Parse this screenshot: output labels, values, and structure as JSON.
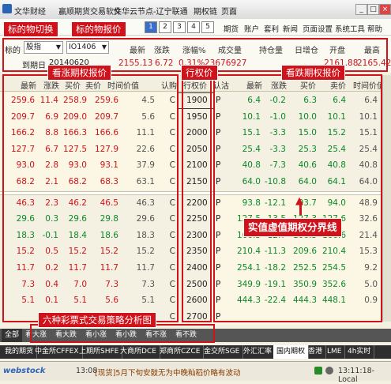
{
  "window": {
    "app_name": "文华财经",
    "title_segments": [
      "赢顺期货交易软件",
      "文华云节点-辽宁联通",
      "期权链",
      "页面"
    ]
  },
  "menu": {
    "items": [
      "期货",
      "账户",
      "套利",
      "新闻",
      "页面设置",
      "系统工具",
      "帮助"
    ],
    "page_numbers": [
      "1",
      "2",
      "3",
      "4",
      "5"
    ],
    "active_page_index": 0
  },
  "selector": {
    "label": "标的",
    "category": "股指",
    "contract": "IO1406",
    "row2_label": "到期日",
    "row2_date": "20140620",
    "headers": [
      "最新",
      "涨跌",
      "涨幅%",
      "成交量",
      "持仓量",
      "日增仓",
      "开盘",
      "最高"
    ],
    "values": [
      "2155.13",
      "6.72",
      "0.31%",
      "23676927",
      "",
      "",
      "2161.88",
      "2165.42"
    ]
  },
  "chain": {
    "call_headers": [
      "最新",
      "涨跌",
      "买价",
      "卖价",
      "时间价值",
      "认购"
    ],
    "strike_header": "行权价",
    "put_headers": [
      "认沽",
      "最新",
      "涨跌",
      "买价",
      "卖价",
      "时间价值"
    ],
    "rows": [
      {
        "call": [
          "259.6",
          "11.4",
          "258.9",
          "259.6",
          "4.5",
          "C"
        ],
        "strike": "1900",
        "put": [
          "P",
          "6.4",
          "-0.2",
          "6.3",
          "6.4",
          "6.4"
        ]
      },
      {
        "call": [
          "209.7",
          "6.9",
          "209.0",
          "209.7",
          "5.6",
          "C"
        ],
        "strike": "1950",
        "put": [
          "P",
          "10.1",
          "-1.0",
          "10.0",
          "10.1",
          "10.1"
        ]
      },
      {
        "call": [
          "166.2",
          "8.8",
          "166.3",
          "166.6",
          "11.1",
          "C"
        ],
        "strike": "2000",
        "put": [
          "P",
          "15.1",
          "-3.3",
          "15.0",
          "15.2",
          "15.1"
        ]
      },
      {
        "call": [
          "127.7",
          "6.7",
          "127.5",
          "127.9",
          "22.6",
          "C"
        ],
        "strike": "2050",
        "put": [
          "P",
          "25.4",
          "-3.3",
          "25.3",
          "25.4",
          "25.4"
        ]
      },
      {
        "call": [
          "93.0",
          "2.8",
          "93.0",
          "93.1",
          "37.9",
          "C"
        ],
        "strike": "2100",
        "put": [
          "P",
          "40.8",
          "-7.3",
          "40.6",
          "40.8",
          "40.8"
        ]
      },
      {
        "call": [
          "68.2",
          "2.1",
          "68.2",
          "68.3",
          "63.1",
          "C"
        ],
        "strike": "2150",
        "put": [
          "P",
          "64.0",
          "-10.8",
          "64.0",
          "64.1",
          "64.0"
        ]
      },
      {
        "call": [
          "46.3",
          "2.3",
          "46.2",
          "46.5",
          "46.3",
          "C"
        ],
        "strike": "2200",
        "put": [
          "P",
          "93.8",
          "-12.1",
          "93.7",
          "94.0",
          "48.9"
        ]
      },
      {
        "call": [
          "29.6",
          "0.3",
          "29.6",
          "29.8",
          "29.6",
          "C"
        ],
        "strike": "2250",
        "put": [
          "P",
          "127.5",
          "-13.5",
          "127.3",
          "127.6",
          "32.6"
        ]
      },
      {
        "call": [
          "18.3",
          "-0.1",
          "18.4",
          "18.6",
          "18.3",
          "C"
        ],
        "strike": "2300",
        "put": [
          "P",
          "166.3",
          "-12.7",
          "166.3",
          "166.6",
          "21.4"
        ]
      },
      {
        "call": [
          "15.2",
          "0.5",
          "15.2",
          "15.2",
          "15.2",
          "C"
        ],
        "strike": "2350",
        "put": [
          "P",
          "210.4",
          "-11.3",
          "209.6",
          "210.4",
          "15.3"
        ]
      },
      {
        "call": [
          "11.7",
          "0.2",
          "11.7",
          "11.7",
          "11.7",
          "C"
        ],
        "strike": "2400",
        "put": [
          "P",
          "254.1",
          "-18.2",
          "252.5",
          "254.5",
          "9.2"
        ]
      },
      {
        "call": [
          "7.3",
          "0.4",
          "7.0",
          "7.3",
          "7.3",
          "C"
        ],
        "strike": "2500",
        "put": [
          "P",
          "349.9",
          "-19.1",
          "350.9",
          "352.6",
          "5.0"
        ]
      },
      {
        "call": [
          "5.1",
          "0.1",
          "5.1",
          "5.6",
          "5.1",
          "C"
        ],
        "strike": "2600",
        "put": [
          "P",
          "444.3",
          "-22.4",
          "444.3",
          "448.1",
          "0.9"
        ]
      },
      {
        "call": [
          "",
          "",
          "",
          "",
          "",
          "C"
        ],
        "strike": "2700",
        "put": [
          "P",
          "",
          "",
          "",
          "",
          ""
        ]
      }
    ]
  },
  "strategy_tabs": [
    "全部",
    "看大涨",
    "看大跌",
    "看小涨",
    "看小跌",
    "看不涨",
    "看不跌"
  ],
  "exchange_tabs": [
    "我的期货",
    "中金所CFFEX",
    "上期所SHFE",
    "大商所DCE",
    "郑商所CZCE",
    "金交所SGE",
    "外汇汇率",
    "国内期权",
    "香港",
    "LME",
    "4h实时"
  ],
  "active_exchange_tab": "国内期权",
  "status": {
    "brand": "webstock",
    "time": "13:08",
    "news": "[现货]5月下旬安鼓无为中晚籼稻价略有波动",
    "clock": "13:11:18-Local"
  },
  "annotations": {
    "underlying_switch": "标的物切换",
    "underlying_quote": "标的物报价",
    "call_quote": "看涨期权报价",
    "strike": "行权价",
    "put_quote": "看跌期权报价",
    "boundary": "实值虚值期权分界线",
    "strategy": "六种彩票式交易策略分析图"
  },
  "colors": {
    "accent_red": "#d0121b",
    "up_red": "#d0121b",
    "down_green": "#0a8a2a",
    "call_strike_bg": "#fbf8ec"
  }
}
